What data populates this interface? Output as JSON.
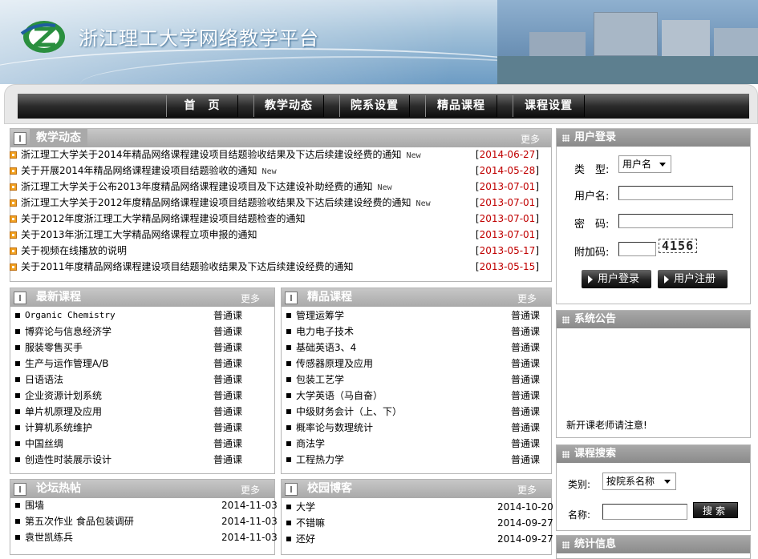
{
  "header": {
    "site_title": "浙江理工大学网络教学平台",
    "logo_icon": "zstu-logo-icon"
  },
  "nav": {
    "items": [
      {
        "label": "首　页"
      },
      {
        "label": "教学动态"
      },
      {
        "label": "院系设置"
      },
      {
        "label": "精品课程"
      },
      {
        "label": "课程设置"
      }
    ]
  },
  "teaching_news": {
    "title": "教学动态",
    "more": "更多",
    "items": [
      {
        "text": "浙江理工大学关于2014年精品网络课程建设项目结题验收结果及下达后续建设经费的通知",
        "new": "New",
        "date": "2014-06-27"
      },
      {
        "text": "关于开展2014年精品网络课程建设项目结题验收的通知",
        "new": "New",
        "date": "2014-05-28"
      },
      {
        "text": "浙江理工大学关于公布2013年度精品网络课程建设项目及下达建设补助经费的通知",
        "new": "New",
        "date": "2013-07-01"
      },
      {
        "text": "浙江理工大学关于2012年度精品网络课程建设项目结题验收结果及下达后续建设经费的通知",
        "new": "New",
        "date": "2013-07-01"
      },
      {
        "text": "关于2012年度浙江理工大学精品网络课程建设项目结题检查的通知",
        "new": "",
        "date": "2013-07-01"
      },
      {
        "text": "关于2013年浙江理工大学精品网络课程立项申报的通知",
        "new": "",
        "date": "2013-07-01"
      },
      {
        "text": "关于视频在线播放的说明",
        "new": "",
        "date": "2013-05-17"
      },
      {
        "text": "关于2011年度精品网络课程建设项目结题验收结果及下达后续建设经费的通知",
        "new": "",
        "date": "2013-05-15"
      }
    ]
  },
  "latest_courses": {
    "title": "最新课程",
    "more": "更多",
    "items": [
      {
        "name": "Organic Chemistry",
        "type": "普通课",
        "mono": true
      },
      {
        "name": "博弈论与信息经济学",
        "type": "普通课"
      },
      {
        "name": "服装零售买手",
        "type": "普通课"
      },
      {
        "name": "生产与运作管理A/B",
        "type": "普通课"
      },
      {
        "name": "日语语法",
        "type": "普通课"
      },
      {
        "name": "企业资源计划系统",
        "type": "普通课"
      },
      {
        "name": "单片机原理及应用",
        "type": "普通课"
      },
      {
        "name": "计算机系统维护",
        "type": "普通课"
      },
      {
        "name": "中国丝绸",
        "type": "普通课"
      },
      {
        "name": "创造性时装展示设计",
        "type": "普通课"
      }
    ]
  },
  "quality_courses": {
    "title": "精品课程",
    "more": "更多",
    "items": [
      {
        "name": "管理运筹学",
        "type": "普通课"
      },
      {
        "name": "电力电子技术",
        "type": "普通课"
      },
      {
        "name": "基础英语3、4",
        "type": "普通课"
      },
      {
        "name": "传感器原理及应用",
        "type": "普通课"
      },
      {
        "name": "包装工艺学",
        "type": "普通课"
      },
      {
        "name": "大学英语（马自奋）",
        "type": "普通课"
      },
      {
        "name": "中级财务会计（上、下）",
        "type": "普通课"
      },
      {
        "name": "概率论与数理统计",
        "type": "普通课"
      },
      {
        "name": "商法学",
        "type": "普通课"
      },
      {
        "name": "工程热力学",
        "type": "普通课"
      }
    ]
  },
  "forum": {
    "title": "论坛热帖",
    "more": "更多",
    "items": [
      {
        "text": "围墙",
        "date": "2014-11-03"
      },
      {
        "text": "第五次作业 食品包装调研",
        "date": "2014-11-03"
      },
      {
        "text": "袁世凯练兵",
        "date": "2014-11-03"
      }
    ]
  },
  "blog": {
    "title": "校园博客",
    "more": "更多",
    "items": [
      {
        "text": "大学",
        "date": "2014-10-20"
      },
      {
        "text": "不错嘛",
        "date": "2014-09-27"
      },
      {
        "text": "还好",
        "date": "2014-09-27"
      }
    ]
  },
  "login": {
    "title": "用户登录",
    "type_label": "类　型:",
    "type_value": "用户名",
    "username_label": "用户名:",
    "password_label": "密　码:",
    "captcha_label": "附加码:",
    "captcha_text": "4156",
    "login_button": "用户登录",
    "register_button": "用户注册"
  },
  "announcement": {
    "title": "系统公告",
    "text": "新开课老师请注意!"
  },
  "course_search": {
    "title": "课程搜索",
    "category_label": "类别:",
    "category_value": "按院系名称",
    "name_label": "名称:",
    "search_button": "搜索"
  },
  "stats": {
    "title": "统计信息"
  }
}
